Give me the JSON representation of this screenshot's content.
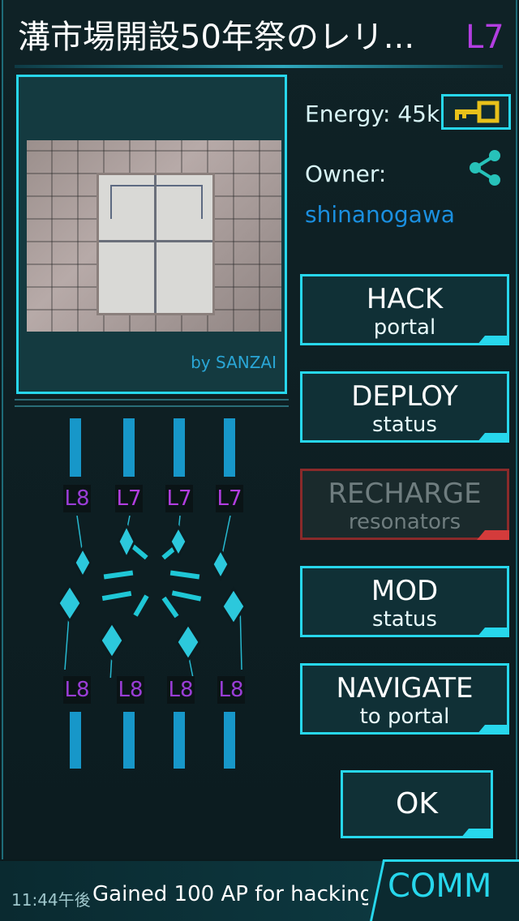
{
  "portal": {
    "title": "溝市場開設50年祭のレリ...",
    "level": "L7",
    "photo_credit": "by SANZAI",
    "energy": "Energy: 45k",
    "owner_label": "Owner:",
    "owner_name": "shinanogawa"
  },
  "buttons": [
    {
      "line1": "HACK",
      "line2": "portal",
      "enabled": true
    },
    {
      "line1": "DEPLOY",
      "line2": "status",
      "enabled": true
    },
    {
      "line1": "RECHARGE",
      "line2": "resonators",
      "enabled": false
    },
    {
      "line1": "MOD",
      "line2": "status",
      "enabled": true
    },
    {
      "line1": "NAVIGATE",
      "line2": "to portal",
      "enabled": true
    }
  ],
  "ok_label": "OK",
  "resonators": {
    "top": [
      "L8",
      "L7",
      "L7",
      "L7"
    ],
    "bottom": [
      "L8",
      "L8",
      "L8",
      "L8"
    ]
  },
  "comm": {
    "tab_label": "COMM",
    "time": "11:44午後",
    "message": "Gained 100 AP for hacking"
  },
  "colors": {
    "accent": "#27d7ec",
    "level_purple": "#b23ee0",
    "owner_blue": "#1a8fe0",
    "key_gold": "#e8c11a",
    "disabled_red": "#d43b3b"
  },
  "icons": {
    "key": "key-icon",
    "share": "share-icon",
    "resonator": "resonator-crystal-icon"
  }
}
